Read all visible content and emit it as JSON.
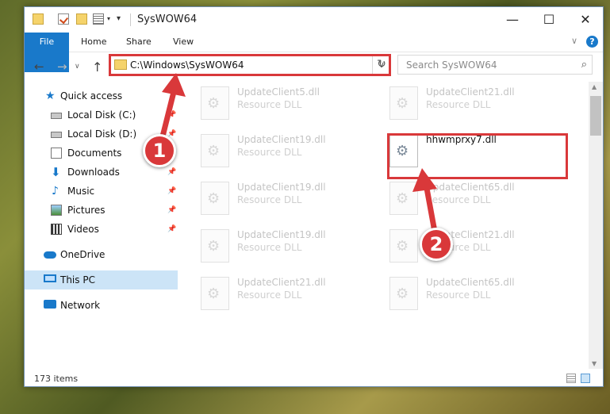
{
  "window": {
    "title": "SysWOW64",
    "minimize": "—",
    "maximize": "☐",
    "close": "✕"
  },
  "ribbon": {
    "tabs": [
      "File",
      "Home",
      "Share",
      "View"
    ]
  },
  "address": {
    "path": "C:\\Windows\\SysWOW64",
    "refresh_icon": "↻"
  },
  "search": {
    "placeholder": "Search SysWOW64"
  },
  "nav": {
    "items": [
      {
        "label": "Quick access",
        "icon": "star-icon"
      },
      {
        "label": "Local Disk (C:)",
        "icon": "drive-icon"
      },
      {
        "label": "Local Disk (D:)",
        "icon": "drive-icon"
      },
      {
        "label": "Documents",
        "icon": "documents-icon"
      },
      {
        "label": "Downloads",
        "icon": "download-icon"
      },
      {
        "label": "Music",
        "icon": "music-icon"
      },
      {
        "label": "Pictures",
        "icon": "pictures-icon"
      },
      {
        "label": "Videos",
        "icon": "videos-icon"
      },
      {
        "label": "OneDrive",
        "icon": "cloud-icon"
      },
      {
        "label": "This PC",
        "icon": "computer-icon"
      },
      {
        "label": "Network",
        "icon": "network-icon"
      }
    ]
  },
  "files": [
    {
      "name": "UpdateClient5.dll",
      "type": "Resource DLL"
    },
    {
      "name": "UpdateClient21.dll",
      "type": "Resource DLL"
    },
    {
      "name": "UpdateClient19.dll",
      "type": "Resource DLL"
    },
    {
      "name": "hhwmprxy7.dll",
      "type": ""
    },
    {
      "name": "UpdateClient19.dll",
      "type": "Resource DLL"
    },
    {
      "name": "UpdateClient65.dll",
      "type": "Resource DLL"
    },
    {
      "name": "UpdateClient19.dll",
      "type": "Resource DLL"
    },
    {
      "name": "UpdateClient21.dll",
      "type": "Resource DLL"
    },
    {
      "name": "UpdateClient21.dll",
      "type": "Resource DLL"
    },
    {
      "name": "UpdateClient65.dll",
      "type": "Resource DLL"
    }
  ],
  "status": {
    "item_count": "173 items"
  },
  "annotations": {
    "step1": "1",
    "step2": "2",
    "color": "#d9383a"
  }
}
